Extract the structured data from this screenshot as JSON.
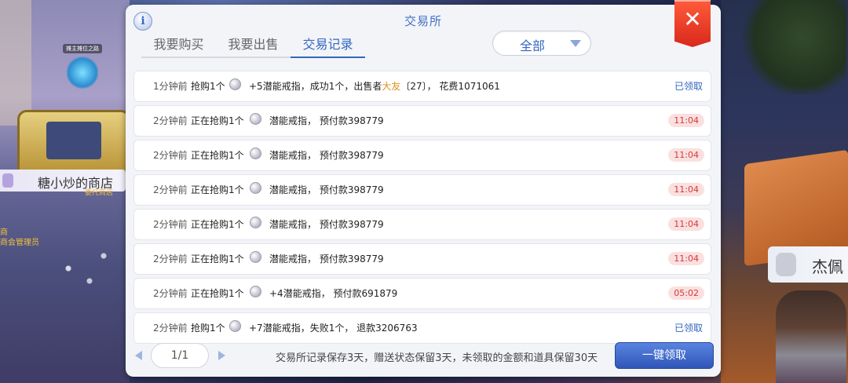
{
  "background": {
    "left_shop_name": "糖小炒的商店",
    "left_shop_sub": "委托商店",
    "left_npc_tag": "摊主摊位之路",
    "left_npc2_line1": "商",
    "left_npc2_line2": "商会管理员",
    "right_shop_name": "杰佩"
  },
  "panel": {
    "title": "交易所",
    "info_label": "i",
    "close_label": "✕",
    "tabs": [
      {
        "label": "我要购买",
        "active": false
      },
      {
        "label": "我要出售",
        "active": false
      },
      {
        "label": "交易记录",
        "active": true
      }
    ],
    "filter_value": "全部"
  },
  "records": [
    {
      "time": "1分钟前",
      "status": "抢购1个",
      "detail_prefix": "+5潜能戒指，成功1个，出售者",
      "seller": "大友",
      "detail_suffix": "〔27〕， 花费1071061",
      "right": "已领取",
      "right_type": "claimed"
    },
    {
      "time": "2分钟前",
      "status": "正在抢购1个",
      "detail_prefix": "潜能戒指， 预付款398779",
      "seller": "",
      "detail_suffix": "",
      "right": "11:04",
      "right_type": "timer"
    },
    {
      "time": "2分钟前",
      "status": "正在抢购1个",
      "detail_prefix": "潜能戒指， 预付款398779",
      "seller": "",
      "detail_suffix": "",
      "right": "11:04",
      "right_type": "timer"
    },
    {
      "time": "2分钟前",
      "status": "正在抢购1个",
      "detail_prefix": "潜能戒指， 预付款398779",
      "seller": "",
      "detail_suffix": "",
      "right": "11:04",
      "right_type": "timer"
    },
    {
      "time": "2分钟前",
      "status": "正在抢购1个",
      "detail_prefix": "潜能戒指， 预付款398779",
      "seller": "",
      "detail_suffix": "",
      "right": "11:04",
      "right_type": "timer"
    },
    {
      "time": "2分钟前",
      "status": "正在抢购1个",
      "detail_prefix": "潜能戒指， 预付款398779",
      "seller": "",
      "detail_suffix": "",
      "right": "11:04",
      "right_type": "timer"
    },
    {
      "time": "2分钟前",
      "status": "正在抢购1个",
      "detail_prefix": "+4潜能戒指， 预付款691879",
      "seller": "",
      "detail_suffix": "",
      "right": "05:02",
      "right_type": "timer"
    },
    {
      "time": "2分钟前",
      "status": "抢购1个",
      "detail_prefix": "+7潜能戒指，失败1个， 退款3206763",
      "seller": "",
      "detail_suffix": "",
      "right": "已领取",
      "right_type": "claimed"
    }
  ],
  "footer": {
    "page": "1/1",
    "note": "交易所记录保存3天，赠送状态保留3天，未领取的金额和道具保留30天",
    "claim_all_label": "一键领取"
  },
  "colors": {
    "accent": "#3566c0",
    "seller": "#e0901a",
    "timer_text": "#d23a3a",
    "close": "#d8281c"
  }
}
